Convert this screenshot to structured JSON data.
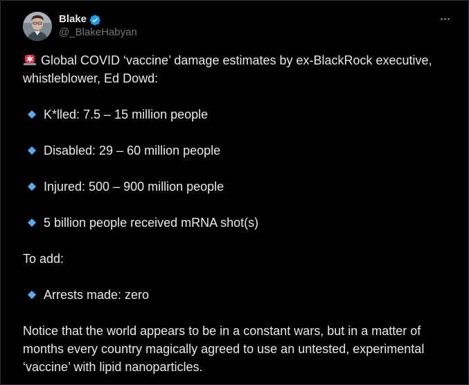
{
  "author": {
    "display_name": "Blake",
    "handle": "@_BlakeHabyan",
    "verified": true
  },
  "post": {
    "intro": "Global COVID ‘vaccine’ damage estimates by ex-BlackRock executive, whistleblower, Ed Dowd:",
    "bullets": [
      "K*lled:  7.5 – 15 million people",
      "Disabled:  29 – 60 million people",
      "Injured:  500 – 900 million people",
      "5 billion people received mRNA shot(s)"
    ],
    "to_add": "To add:",
    "extra_bullet": "Arrests made: zero",
    "closing": "Notice that the world appears to be in a constant wars, but in a matter of months every country magically agreed to use an untested, experimental ‘vaccine’ with lipid nanoparticles."
  },
  "icons": {
    "verified": "verified-badge-icon",
    "more": "more-options-icon",
    "siren": "police-light-emoji",
    "bullet": "small-blue-diamond-emoji"
  },
  "colors": {
    "background": "#000000",
    "text": "#e7e9ea",
    "muted": "#71767b",
    "verified_blue": "#1d9bf0",
    "diamond_blue": "#55acee",
    "siren_red": "#dd2e44"
  }
}
